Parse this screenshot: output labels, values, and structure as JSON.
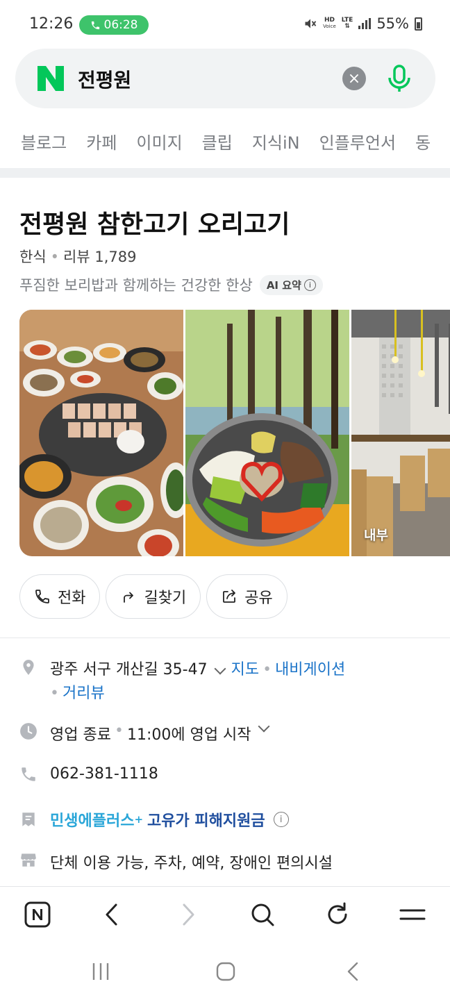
{
  "status_bar": {
    "time": "12:26",
    "call_timer": "06:28",
    "network_hd": "HD",
    "network_hd_sub": "Voice",
    "network_lte": "LTE",
    "battery": "55%"
  },
  "search": {
    "query": "전평원",
    "clear_symbol": "×"
  },
  "tabs": [
    {
      "label": "블로그"
    },
    {
      "label": "카페"
    },
    {
      "label": "이미지"
    },
    {
      "label": "클립"
    },
    {
      "label": "지식iN"
    },
    {
      "label": "인플루언서"
    },
    {
      "label": "동"
    }
  ],
  "place": {
    "name": "전평원 참한고기 오리고기",
    "category": "한식",
    "review_label": "리뷰 1,789",
    "description": "푸짐한 보리밥과 함께하는 건강한 한상",
    "ai_summary_label": "AI 요약",
    "photos": [
      {
        "label": ""
      },
      {
        "label": ""
      },
      {
        "label": "내부"
      }
    ]
  },
  "actions": {
    "call": "전화",
    "directions": "길찾기",
    "share": "공유"
  },
  "info": {
    "address": "광주 서구 개산길 35-47",
    "map_link": "지도",
    "navigation_link": "내비게이션",
    "street_view_link": "거리뷰",
    "hours_status": "영업 종료",
    "hours_next": "11:00에 영업 시작",
    "phone": "062-381-1118",
    "promo_brand": "민생에플러스",
    "promo_plus": "+",
    "promo_text": "고유가 피해지원금",
    "facilities": "단체 이용 가능, 주차, 예약, 장애인 편의시설"
  },
  "colors": {
    "naver_green": "#03c75a",
    "link_blue": "#1a73c8",
    "call_pill": "#3ec36b"
  }
}
